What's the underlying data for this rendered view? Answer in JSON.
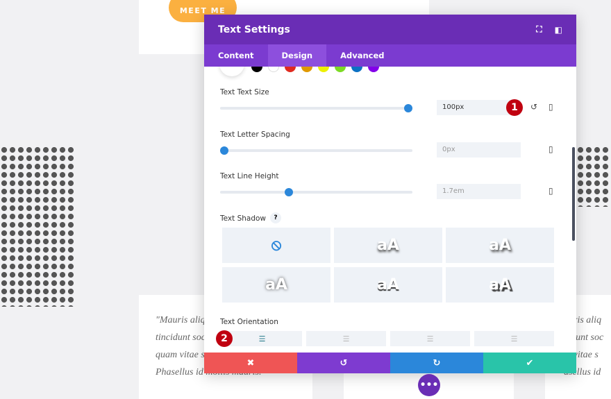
{
  "background": {
    "button": "MEET ME",
    "quote_left": [
      "\"Mauris aliquet",
      "tincidunt sociis",
      "quam vitae s",
      "Phasellus id mollis mauris."
    ],
    "quote_right": [
      "auris aliq",
      "cidunt soc",
      "m vitae s",
      "asellus id"
    ]
  },
  "modal": {
    "title": "Text Settings",
    "icons": [
      "fullscreen-icon",
      "split-view-icon"
    ],
    "tabs": [
      {
        "label": "Content"
      },
      {
        "label": "Design",
        "active": true
      },
      {
        "label": "Advanced"
      }
    ],
    "colors": [
      "#000000",
      "#ffffff",
      "#e02b20",
      "#e09900",
      "#edf000",
      "#7cda24",
      "#0c71c3",
      "#8300e9"
    ],
    "text_size": {
      "label": "Text Text Size",
      "value": "100px",
      "percent": 100
    },
    "letter_spacing": {
      "label": "Text Letter Spacing",
      "value": "0px",
      "percent": 0
    },
    "line_height": {
      "label": "Text Line Height",
      "value": "1.7em",
      "percent": 35
    },
    "shadow": {
      "label": "Text Shadow",
      "help": "?",
      "options": [
        "none",
        "aA",
        "aA",
        "aA",
        "aA",
        "aA"
      ]
    },
    "orientation": {
      "label": "Text Orientation",
      "options": [
        "left",
        "center",
        "right",
        "justify"
      ],
      "selected": "left"
    },
    "badges": [
      "1",
      "2"
    ],
    "footer": {
      "cancel": "✖",
      "undo": "↺",
      "redo": "↻",
      "save": "✔"
    },
    "footer_colors": [
      "#ef5555",
      "#7e3bd0",
      "#2b87da",
      "#29c4a9"
    ]
  }
}
